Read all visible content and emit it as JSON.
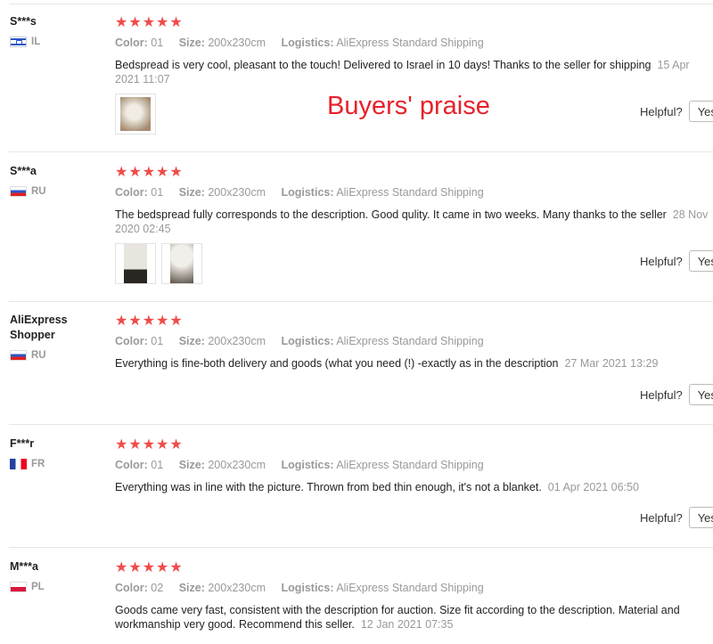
{
  "overlay": {
    "praise_text": "Buyers' praise"
  },
  "meta_labels": {
    "color": "Color:",
    "size": "Size:",
    "logistics": "Logistics:"
  },
  "helpful": {
    "label": "Helpful?",
    "yes": "Yes"
  },
  "rating_display": "★★★★★",
  "reviews": [
    {
      "user": "S***s",
      "country": "IL",
      "rating": 5,
      "color": "01",
      "size": "200x230cm",
      "logistics": "AliExpress Standard Shipping",
      "text": "Bedspread is very cool, pleasant to the touch! Delivered to Israel in 10 days! Thanks to the seller for shipping",
      "date": "15 Apr 2021 11:07",
      "photos": 1
    },
    {
      "user": "S***a",
      "country": "RU",
      "rating": 5,
      "color": "01",
      "size": "200x230cm",
      "logistics": "AliExpress Standard Shipping",
      "text": "The bedspread fully corresponds to the description. Good qulity. It came in two weeks. Many thanks to the seller",
      "date": "28 Nov 2020 02:45",
      "photos": 2
    },
    {
      "user": "AliExpress Shopper",
      "country": "RU",
      "rating": 5,
      "color": "01",
      "size": "200x230cm",
      "logistics": "AliExpress Standard Shipping",
      "text": "Everything is fine-both delivery and goods (what you need (!) -exactly as in the description",
      "date": "27 Mar 2021 13:29",
      "photos": 0
    },
    {
      "user": "F***r",
      "country": "FR",
      "rating": 5,
      "color": "01",
      "size": "200x230cm",
      "logistics": "AliExpress Standard Shipping",
      "text": "Everything was in line with the picture. Thrown from bed thin enough, it's not a blanket.",
      "date": "01 Apr 2021 06:50",
      "photos": 0
    },
    {
      "user": "M***a",
      "country": "PL",
      "rating": 5,
      "color": "02",
      "size": "200x230cm",
      "logistics": "AliExpress Standard Shipping",
      "text": "Goods came very fast, consistent with the description for auction. Size fit according to the description. Material and workmanship very good. Recommend this seller.",
      "date": "12 Jan 2021 07:35",
      "photos": 0
    }
  ]
}
